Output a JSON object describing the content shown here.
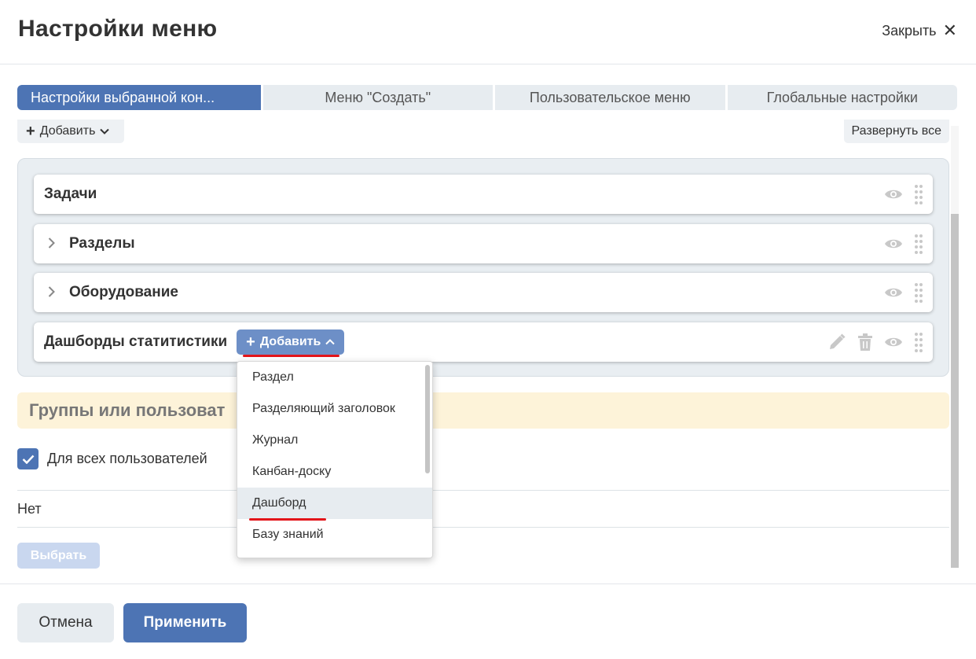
{
  "header": {
    "title": "Настройки меню",
    "close_label": "Закрыть"
  },
  "tabs": [
    {
      "label": "Настройки выбранной кон..."
    },
    {
      "label": "Меню \"Создать\""
    },
    {
      "label": "Пользовательское меню"
    },
    {
      "label": "Глобальные настройки"
    }
  ],
  "toolbar": {
    "add_label": "Добавить",
    "expand_all_label": "Развернуть все"
  },
  "menu_items": [
    {
      "label": "Задачи"
    },
    {
      "label": "Разделы"
    },
    {
      "label": "Оборудование"
    },
    {
      "label": "Дашборды статитистики",
      "add_label": "Добавить"
    }
  ],
  "dropdown": {
    "items": [
      {
        "label": "Раздел"
      },
      {
        "label": "Разделяющий заголовок"
      },
      {
        "label": "Журнал"
      },
      {
        "label": "Канбан-доску"
      },
      {
        "label": "Дашборд"
      },
      {
        "label": "Базу знаний"
      }
    ]
  },
  "groups": {
    "banner": "Группы или пользоват",
    "all_users_label": "Для всех пользователей",
    "all_users_checked": true,
    "none_text": "Нет",
    "choose_label": "Выбрать"
  },
  "footer": {
    "cancel_label": "Отмена",
    "apply_label": "Применить"
  },
  "colors": {
    "accent": "#4d74b4",
    "accent_light": "#6d8fc7",
    "highlight_line": "#e3151a",
    "banner": "#fdf3d9"
  }
}
